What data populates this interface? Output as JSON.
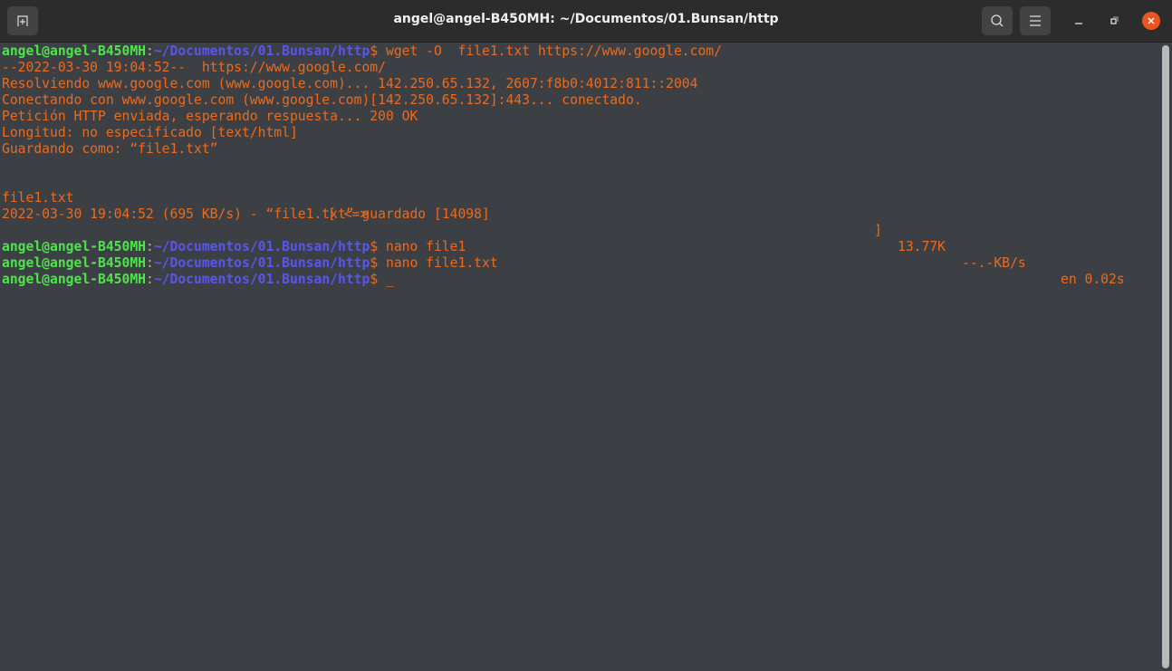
{
  "window": {
    "title": "angel@angel-B450MH: ~/Documentos/01.Bunsan/http"
  },
  "prompt": {
    "user": "angel@angel-B450MH",
    "colon": ":",
    "path": "~/Documentos/01.Bunsan/http",
    "dollar": "$ "
  },
  "commands": [
    "wget -O  file1.txt https://www.google.com/",
    "nano file1",
    "nano file1.txt",
    "_"
  ],
  "output": [
    "--2022-03-30 19:04:52--  https://www.google.com/",
    "Resolviendo www.google.com (www.google.com)... 142.250.65.132, 2607:f8b0:4012:811::2004",
    "Conectando con www.google.com (www.google.com)[142.250.65.132]:443... conectado.",
    "Petición HTTP enviada, esperando respuesta... 200 OK",
    "Longitud: no especificado [text/html]",
    "Guardando como: “file1.txt”"
  ],
  "progress": {
    "file": "file1.txt",
    "bar_start": "[ <=>",
    "bar_end": "]",
    "size": "13.77K",
    "speed": "--.-KB/s",
    "time": "en 0.02s"
  },
  "saved": "2022-03-30 19:04:52 (695 KB/s) - “file1.txt” guardado [14098]"
}
